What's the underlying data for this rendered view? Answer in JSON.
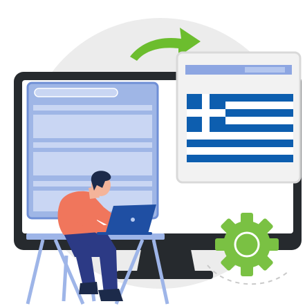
{
  "colors": {
    "background": "#ffffff",
    "circle": "#ececec",
    "monitor_frame": "#262a2e",
    "screen": "#ffffff",
    "form_panel": "#9fb6e6",
    "form_panel_border": "#6f8fd6",
    "form_field": "#c9d6f3",
    "card": "#f2f2f2",
    "card_border": "#d9d9d9",
    "card_header": "#8da6e2",
    "flag_blue": "#0d5eaf",
    "flag_white": "#ffffff",
    "arrow_green": "#6cbd2e",
    "gear_green": "#7ac143",
    "person_shirt": "#f0765c",
    "person_pants": "#2c3a85",
    "person_skin": "#f4b49a",
    "person_hair": "#1c2a4a",
    "laptop": "#1f4fa3",
    "desk": "#9eb5e8"
  },
  "icons": {
    "monitor": "monitor-icon",
    "arrow": "curved-arrow-icon",
    "flag": "greek-flag-icon",
    "gear": "gear-icon",
    "person": "person-with-laptop"
  }
}
